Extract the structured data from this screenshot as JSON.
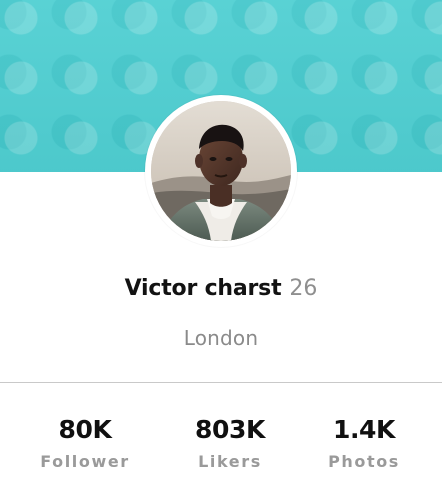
{
  "profile": {
    "name": "Victor charst",
    "age": "26",
    "location": "London",
    "avatar_icon": "profile-photo"
  },
  "stats": [
    {
      "value": "80K",
      "label": "Follower"
    },
    {
      "value": "803K",
      "label": "Likers"
    },
    {
      "value": "1.4K",
      "label": "Photos"
    }
  ],
  "colors": {
    "banner": "#4fcfd2",
    "name": "#121212",
    "muted": "#8f8f8f",
    "divider": "#c9c9c9"
  }
}
